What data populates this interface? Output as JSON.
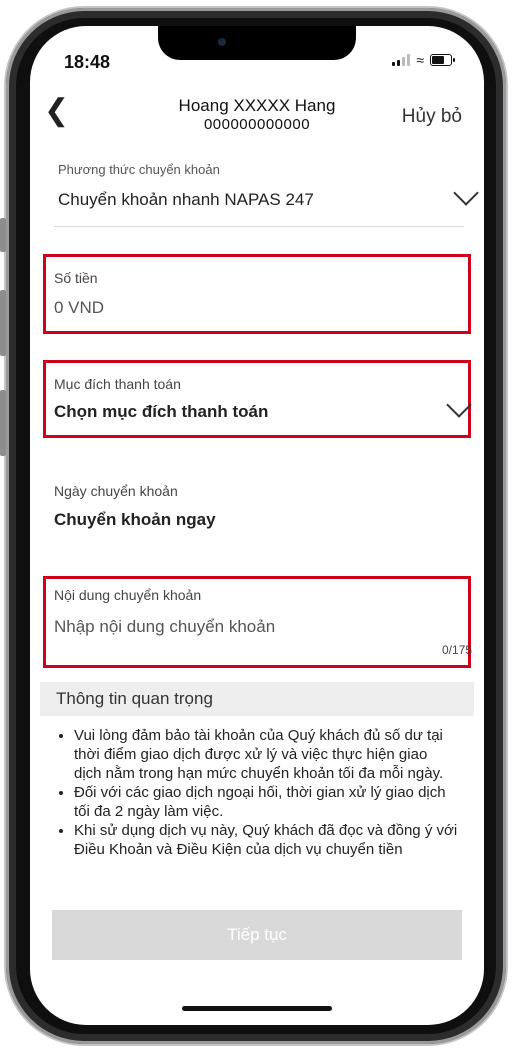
{
  "status_bar": {
    "time": "18:48"
  },
  "header": {
    "recipient_name": "Hoang XXXXX  Hang",
    "account_number": "000000000000",
    "cancel_label": "Hủy bỏ"
  },
  "form": {
    "transfer_method": {
      "label": "Phương thức chuyển khoản",
      "value": "Chuyển khoản nhanh NAPAS 247"
    },
    "amount": {
      "label": "Số tiền",
      "placeholder": "0 VND"
    },
    "purpose": {
      "label": "Mục đích thanh toán",
      "value": "Chọn mục đích thanh toán"
    },
    "transfer_date": {
      "label": "Ngày chuyển khoản",
      "value": "Chuyển khoản ngay"
    },
    "content": {
      "label": "Nội dung chuyển khoản",
      "placeholder": "Nhập nội dung chuyển khoản",
      "counter": "0/175"
    }
  },
  "important": {
    "title": "Thông tin quan trọng",
    "notes": [
      "Vui lòng đảm bảo tài khoản của Quý khách đủ số dư tại thời điểm giao dịch được xử lý và việc thực hiện giao dịch nằm trong hạn mức chuyển khoản tối đa mỗi ngày.",
      "Đối với các giao dịch ngoại hối, thời gian xử lý giao dịch tối đa 2 ngày làm việc.",
      "Khi sử dụng dịch vụ này, Quý khách đã đọc và đồng ý với Điều Khoản và Điều Kiện của dịch vụ chuyển tiền"
    ]
  },
  "actions": {
    "continue_label": "Tiếp tục"
  },
  "colors": {
    "highlight_border": "#d0021b",
    "disabled_button": "#d9d9d9"
  }
}
